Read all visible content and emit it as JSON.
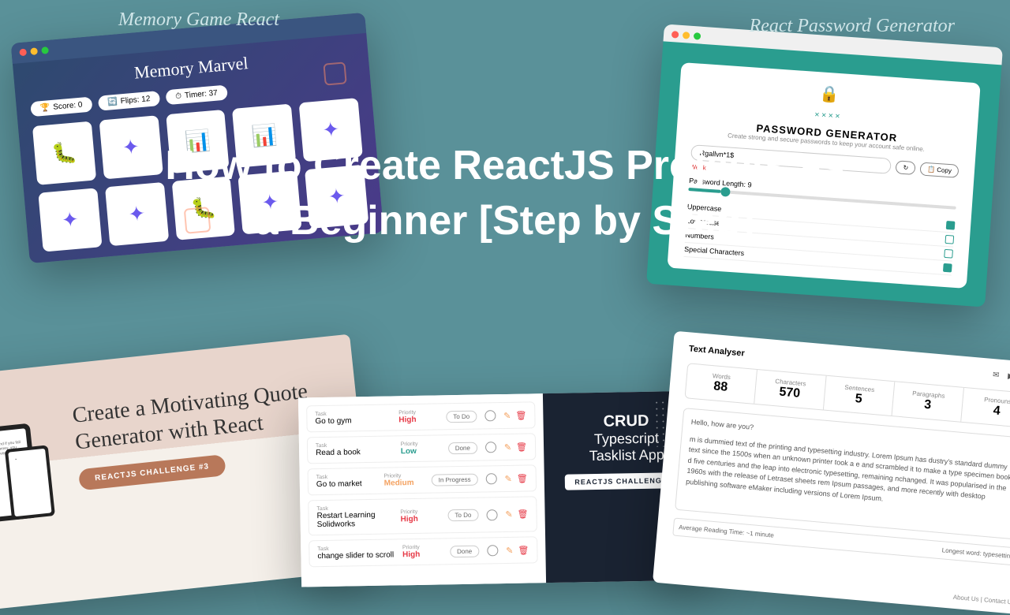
{
  "title": "How to Create ReactJS Projects as a Beginner [Step by Step]",
  "labels": {
    "memory": "Memory Game React",
    "pwd": "React Password Generator"
  },
  "memory": {
    "title": "Memory Marvel",
    "score": "Score: 0",
    "flips": "Flips: 12",
    "timer": "Timer: 37"
  },
  "pwd": {
    "title": "PASSWORD GENERATOR",
    "subtitle": "Create strong and secure passwords to keep your account safe online.",
    "value": "Rgallyn*1$",
    "copy": "Copy",
    "weak": "Weak",
    "length": "Password Length: 9",
    "opts": [
      "Uppercase",
      "Lowercase",
      "Numbers",
      "Special Characters"
    ]
  },
  "quote": {
    "title": "Create a Motivating Quote Generator with React",
    "badge": "REACTJS CHALLENGE #3"
  },
  "tasks": {
    "items": [
      {
        "name": "Go to gym",
        "prio": "High",
        "pc": "prio-high",
        "status": "To Do"
      },
      {
        "name": "Read a book",
        "prio": "Low",
        "pc": "prio-low",
        "status": "Done"
      },
      {
        "name": "Go to market",
        "prio": "Medium",
        "pc": "prio-med",
        "status": "In Progress"
      },
      {
        "name": "Restart Learning Solidworks",
        "prio": "High",
        "pc": "prio-high",
        "status": "To Do"
      },
      {
        "name": "change slider to scroll",
        "prio": "High",
        "pc": "prio-high",
        "status": "Done"
      }
    ],
    "crud_title": "CRUD",
    "crud_sub1": "Typescript",
    "crud_sub2": "Tasklist App",
    "crud_badge": "REACTJS CHALLENGE #4",
    "lbl_task": "Task",
    "lbl_prio": "Priority"
  },
  "analyser": {
    "title": "Text Analyser",
    "stats": [
      {
        "l": "Words",
        "v": "88"
      },
      {
        "l": "Characters",
        "v": "570"
      },
      {
        "l": "Sentences",
        "v": "5"
      },
      {
        "l": "Paragraphs",
        "v": "3"
      },
      {
        "l": "Pronouns",
        "v": "4"
      }
    ],
    "greeting": "Hello, how are you?",
    "body": "m is dummied text of the printing and typesetting industry. Lorem Ipsum has dustry's standard dummy text since the 1500s when an unknown printer took a e and scrambled it to make a type specimen book. d five centuries and the leap into electronic typesetting, remaining nchanged. It was popularised in the 1960s with the release of Letraset sheets rem Ipsum passages, and more recently with desktop publishing software eMaker including versions of Lorem Ipsum.",
    "reading": "Average Reading Time: ~1 minute",
    "longest": "Longest word: typesetting",
    "footer": "About Us | Contact Us"
  }
}
